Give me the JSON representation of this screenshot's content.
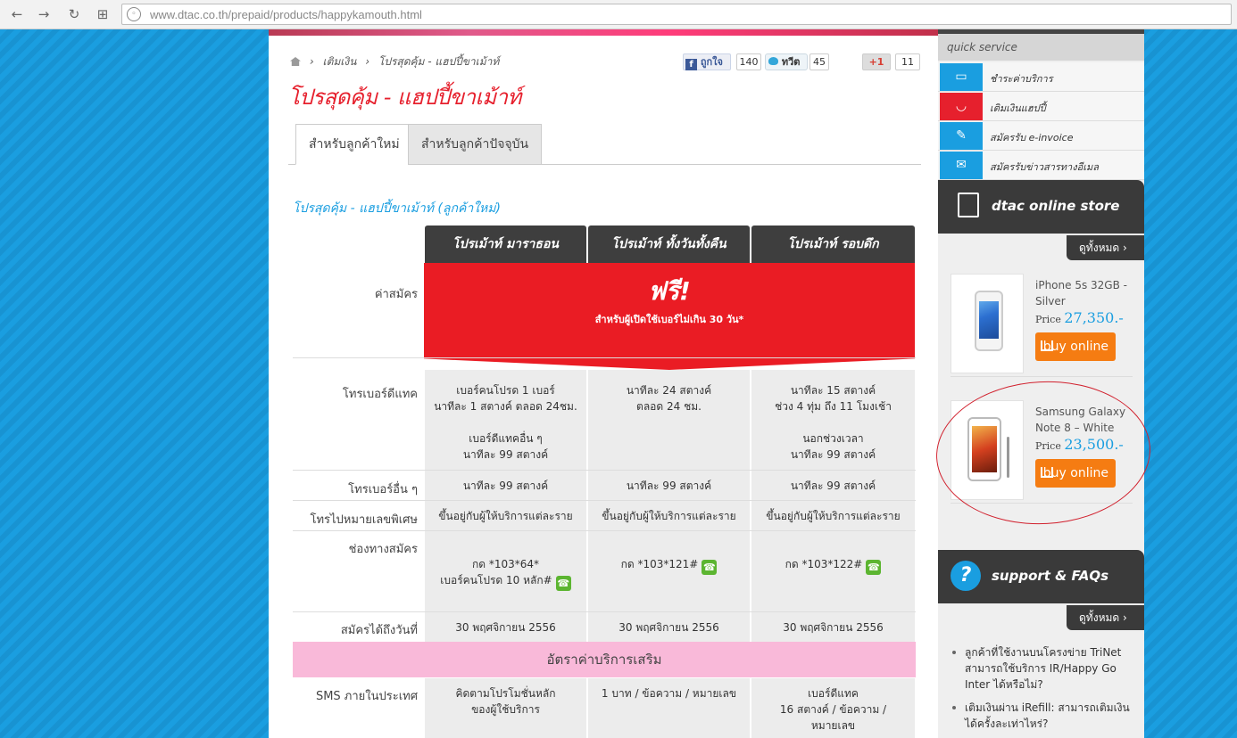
{
  "browser": {
    "url": "www.dtac.co.th/prepaid/products/happykamouth.html",
    "back": "←",
    "forward": "→",
    "reload": "↻",
    "apps": "⊞"
  },
  "breadcrumb": {
    "items": [
      "เติมเงิน",
      "โปรสุดคุ้ม - แฮปปี้ขาเม้าท์"
    ]
  },
  "share": {
    "facebook_label": "ถูกใจ",
    "facebook_count": "140",
    "twitter_label": "ทวีต",
    "twitter_count": "45",
    "gplus_label": "+1",
    "gplus_count": "11"
  },
  "page": {
    "title": "โปรสุดคุ้ม - แฮปปี้ขาเม้าท์",
    "tabs": [
      {
        "label": "สำหรับลูกค้าใหม่",
        "active": true
      },
      {
        "label": "สำหรับลูกค้าปัจจุบัน",
        "active": false
      }
    ],
    "subtitle": "โปรสุดคุ้ม - แฮปปี้ขาเม้าท์ (ลูกค้าใหม่)"
  },
  "table": {
    "columns": [
      "โปรเม้าท์ มาราธอน",
      "โปรเม้าท์ ทั้งวันทั้งคืน",
      "โปรเม้าท์ รอบดึก"
    ],
    "fee_label": "ค่าสมัคร",
    "fee_big": "ฟรี!",
    "fee_small": "สำหรับผู้เปิดใช้เบอร์ไม่เกิน 30 วัน*",
    "rows": [
      {
        "label": "โทรเบอร์ดีแทค",
        "cells": [
          "เบอร์คนโปรด 1 เบอร์\nนาทีละ 1 สตางค์ ตลอด 24ชม.\n\nเบอร์ดีแทคอื่น ๆ\nนาทีละ 99 สตางค์",
          "นาทีละ 24 สตางค์\nตลอด 24 ชม.",
          "นาทีละ 15 สตางค์\nช่วง 4 ทุ่ม ถึง 11 โมงเช้า\n\nนอกช่วงเวลา\nนาทีละ 99 สตางค์"
        ]
      },
      {
        "label": "โทรเบอร์อื่น ๆ",
        "cells": [
          "นาทีละ 99 สตางค์",
          "นาทีละ 99 สตางค์",
          "นาทีละ 99 สตางค์"
        ]
      },
      {
        "label": "โทรไปหมายเลขพิเศษ",
        "cells": [
          "ขึ้นอยู่กับผู้ให้บริการแต่ละราย",
          "ขึ้นอยู่กับผู้ให้บริการแต่ละราย",
          "ขึ้นอยู่กับผู้ให้บริการแต่ละราย"
        ]
      },
      {
        "label": "ช่องทางสมัคร",
        "cells": [
          "กด *103*64*\nเบอร์คนโปรด 10 หลัก#",
          "กด *103*121#",
          "กด *103*122#"
        ]
      },
      {
        "label": "สมัครได้ถึงวันที่",
        "cells": [
          "30 พฤศจิกายน 2556",
          "30 พฤศจิกายน 2556",
          "30 พฤศจิกายน 2556"
        ]
      }
    ],
    "extra_header": "อัตราค่าบริการเสริม",
    "sms_row": {
      "label": "SMS ภายในประเทศ",
      "cells": [
        "คิดตามโปรโมชั่นหลัก\nของผู้ใช้บริการ",
        "1 บาท / ข้อความ / หมายเลข",
        "เบอร์ดีแทค\n16 สตางค์ / ข้อความ /\nหมายเลข"
      ]
    }
  },
  "sidebar": {
    "quick_service_title": "quick service",
    "quick_items": [
      {
        "label": "ชำระค่าบริการ",
        "icon": "card-icon"
      },
      {
        "label": "เติมเงินแฮปปี้",
        "icon": "happy-smile-icon"
      },
      {
        "label": "สมัครรับ e-invoice",
        "icon": "edit-icon"
      },
      {
        "label": "สมัครรับข่าวสารทางอีเมล",
        "icon": "mail-icon"
      }
    ],
    "store_title": "dtac online store",
    "see_all": "ดูทั้งหมด",
    "products": [
      {
        "name": "iPhone 5s 32GB - Silver",
        "price_label": "Price",
        "price": "27,350.-",
        "buy": "buy online"
      },
      {
        "name": "Samsung Galaxy Note 8 – White",
        "price_label": "Price",
        "price": "23,500.-",
        "buy": "buy online"
      }
    ],
    "support_title": "support & FAQs",
    "faqs": [
      "ลูกค้าที่ใช้งานบนโครงข่าย TriNet สามารถใช้บริการ IR/Happy Go Inter ได้หรือไม่?",
      "เติมเงินผ่าน iRefill: สามารถเติมเงินได้ครั้งละเท่าไหร่?"
    ]
  },
  "colors": {
    "brand_blue": "#1a9ee0",
    "brand_red": "#ea1c24",
    "buy_orange": "#f57c12",
    "pink_row": "#f9b9d9"
  }
}
